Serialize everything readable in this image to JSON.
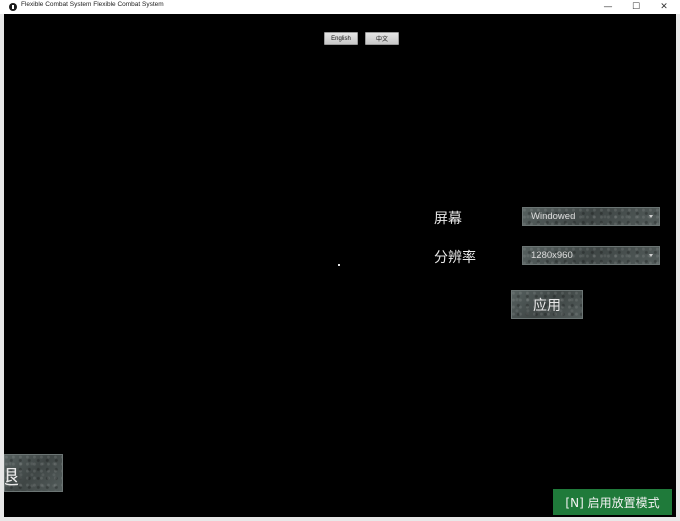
{
  "window": {
    "title": "Flexible Combat System Flexible Combat System",
    "minimize_glyph": "—",
    "maximize_glyph": "☐",
    "close_glyph": "✕"
  },
  "language": {
    "english_label": "English",
    "chinese_label": "中文"
  },
  "settings": {
    "screen_label": "屏幕",
    "screen_value": "Windowed",
    "resolution_label": "分辨率",
    "resolution_value": "1280x960",
    "apply_label": "应用"
  },
  "back_button": {
    "label": "退"
  },
  "place_mode": {
    "label": "[N] 启用放置模式"
  },
  "colors": {
    "background": "#000000",
    "accent_green": "#1f7a3a",
    "stone_gray": "#4a5150"
  }
}
